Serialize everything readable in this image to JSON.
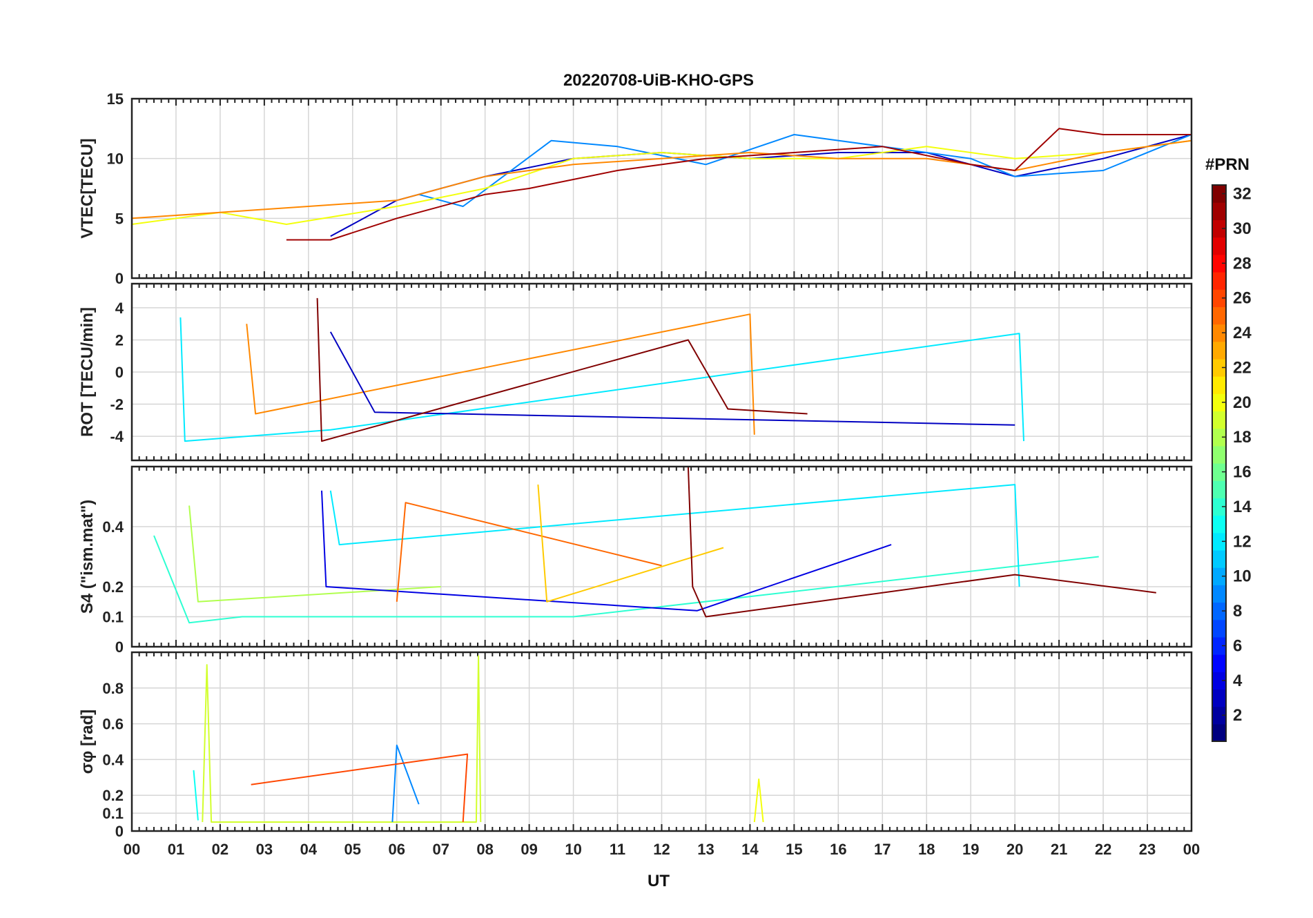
{
  "figure": {
    "title": "20220708-UiB-KHO-GPS",
    "xlabel": "UT",
    "x_tick_labels": [
      "00",
      "01",
      "02",
      "03",
      "04",
      "05",
      "06",
      "07",
      "08",
      "09",
      "10",
      "11",
      "12",
      "13",
      "14",
      "15",
      "16",
      "17",
      "18",
      "19",
      "20",
      "21",
      "22",
      "23",
      "00"
    ]
  },
  "colorbar": {
    "title": "#PRN",
    "range": [
      1,
      32
    ],
    "tick_labels": [
      "2",
      "4",
      "6",
      "8",
      "10",
      "12",
      "14",
      "16",
      "18",
      "20",
      "22",
      "24",
      "26",
      "28",
      "30",
      "32"
    ],
    "tick_values": [
      2,
      4,
      6,
      8,
      10,
      12,
      14,
      16,
      18,
      20,
      22,
      24,
      26,
      28,
      30,
      32
    ],
    "colormap": "jet"
  },
  "chart_data": [
    {
      "type": "line",
      "panel": "vtec",
      "ylabel": "VTEC[TECU]",
      "ylim": [
        0,
        15
      ],
      "y_tick_labels": [
        "0",
        "5",
        "10",
        "15"
      ],
      "y_ticks": [
        0,
        5,
        10,
        15
      ],
      "xlim": [
        0,
        24
      ],
      "grid": true,
      "series": [
        {
          "prn": 3,
          "x": [
            4.5,
            6,
            8,
            10,
            12,
            14,
            16,
            18,
            20,
            22,
            24
          ],
          "y": [
            3.5,
            6.5,
            8.5,
            10,
            10.5,
            10,
            10.5,
            10.5,
            8.5,
            10,
            12
          ]
        },
        {
          "prn": 9,
          "x": [
            6.5,
            7.5,
            9.5,
            11,
            13,
            15,
            17,
            19,
            20,
            22,
            24
          ],
          "y": [
            7,
            6,
            11.5,
            11,
            9.5,
            12,
            11,
            10,
            8.5,
            9,
            12
          ]
        },
        {
          "prn": 20,
          "x": [
            0,
            2,
            3.5,
            6,
            8,
            10,
            12,
            14,
            16,
            18,
            20,
            22,
            24
          ],
          "y": [
            4.5,
            5.5,
            4.5,
            6,
            7.5,
            10,
            10.5,
            10,
            10,
            11,
            10,
            10.5,
            11.5
          ]
        },
        {
          "prn": 24,
          "x": [
            0,
            2,
            4,
            6,
            8,
            10,
            12,
            14,
            16,
            18,
            20,
            22,
            24
          ],
          "y": [
            5,
            5.5,
            6,
            6.5,
            8.5,
            9.5,
            10,
            10.5,
            10,
            10,
            9,
            10.5,
            11.5
          ]
        },
        {
          "prn": 31,
          "x": [
            3.5,
            4.5,
            6,
            8,
            9,
            11,
            13,
            15,
            17,
            19,
            20,
            21,
            22,
            24
          ],
          "y": [
            3.2,
            3.2,
            5,
            7,
            7.5,
            9,
            10,
            10.5,
            11,
            9.5,
            9,
            12.5,
            12,
            12
          ]
        }
      ]
    },
    {
      "type": "line",
      "panel": "rot",
      "ylabel": "ROT [TECU/min]",
      "ylim": [
        -5.5,
        5.5
      ],
      "y_tick_labels": [
        "-4",
        "-2",
        "0",
        "2",
        "4"
      ],
      "y_ticks": [
        -4,
        -2,
        0,
        2,
        4
      ],
      "xlim": [
        0,
        24
      ],
      "grid": true,
      "series": [
        {
          "prn": 12,
          "x": [
            1.1,
            1.2,
            4.5,
            20.1,
            20.2
          ],
          "y": [
            3.4,
            -4.3,
            -3.6,
            2.4,
            -4.3
          ]
        },
        {
          "prn": 24,
          "x": [
            2.6,
            2.8,
            14,
            14.1
          ],
          "y": [
            3,
            -2.6,
            3.6,
            -3.9
          ]
        },
        {
          "prn": 3,
          "x": [
            4.5,
            5.5,
            20.0
          ],
          "y": [
            2.5,
            -2.5,
            -3.3
          ]
        },
        {
          "prn": 32,
          "x": [
            4.2,
            4.3,
            12.6,
            13.5,
            15.3
          ],
          "y": [
            4.6,
            -4.3,
            2,
            -2.3,
            -2.6
          ]
        }
      ]
    },
    {
      "type": "line",
      "panel": "s4",
      "ylabel": "S4 (\"ism.mat\")",
      "ylim": [
        0,
        0.6
      ],
      "y_tick_labels": [
        "0",
        "0.1",
        "0.2",
        "0.4"
      ],
      "y_ticks": [
        0,
        0.1,
        0.2,
        0.4
      ],
      "xlim": [
        0,
        24
      ],
      "grid": true,
      "series": [
        {
          "prn": 14,
          "x": [
            0.5,
            1.3,
            2.5,
            10,
            21.9
          ],
          "y": [
            0.37,
            0.08,
            0.1,
            0.1,
            0.3
          ]
        },
        {
          "prn": 18,
          "x": [
            1.3,
            1.5,
            7.0
          ],
          "y": [
            0.47,
            0.15,
            0.2
          ]
        },
        {
          "prn": 4,
          "x": [
            4.3,
            4.4,
            12.8,
            17.2
          ],
          "y": [
            0.52,
            0.2,
            0.12,
            0.34
          ]
        },
        {
          "prn": 12,
          "x": [
            4.5,
            4.7,
            20.0,
            20.1
          ],
          "y": [
            0.52,
            0.34,
            0.54,
            0.2
          ]
        },
        {
          "prn": 25,
          "x": [
            6.0,
            6.2,
            12.0
          ],
          "y": [
            0.15,
            0.48,
            0.27
          ]
        },
        {
          "prn": 22,
          "x": [
            9.2,
            9.4,
            13.4
          ],
          "y": [
            0.54,
            0.15,
            0.33
          ]
        },
        {
          "prn": 32,
          "x": [
            12.6,
            12.7,
            13.0,
            20.0,
            23.2
          ],
          "y": [
            0.6,
            0.2,
            0.1,
            0.24,
            0.18
          ]
        }
      ]
    },
    {
      "type": "line",
      "panel": "sigma_phi",
      "ylabel": "σφ [rad]",
      "ylim": [
        0,
        1.0
      ],
      "y_tick_labels": [
        "0",
        "0.1",
        "0.2",
        "0.4",
        "0.6",
        "0.8"
      ],
      "y_ticks": [
        0,
        0.1,
        0.2,
        0.4,
        0.6,
        0.8
      ],
      "xlim": [
        0,
        24
      ],
      "grid": true,
      "series": [
        {
          "prn": 19,
          "x": [
            1.6,
            1.7,
            1.8,
            7.8,
            7.85,
            7.9
          ],
          "y": [
            0.05,
            0.93,
            0.05,
            0.05,
            0.98,
            0.05
          ]
        },
        {
          "prn": 13,
          "x": [
            1.4,
            1.5
          ],
          "y": [
            0.34,
            0.06
          ]
        },
        {
          "prn": 9,
          "x": [
            5.9,
            6.0,
            6.5
          ],
          "y": [
            0.05,
            0.48,
            0.15
          ]
        },
        {
          "prn": 26,
          "x": [
            7.5,
            7.6,
            2.7
          ],
          "y": [
            0.05,
            0.43,
            0.26
          ]
        },
        {
          "prn": 20,
          "x": [
            14.1,
            14.2,
            14.3
          ],
          "y": [
            0.05,
            0.29,
            0.05
          ]
        }
      ]
    }
  ]
}
